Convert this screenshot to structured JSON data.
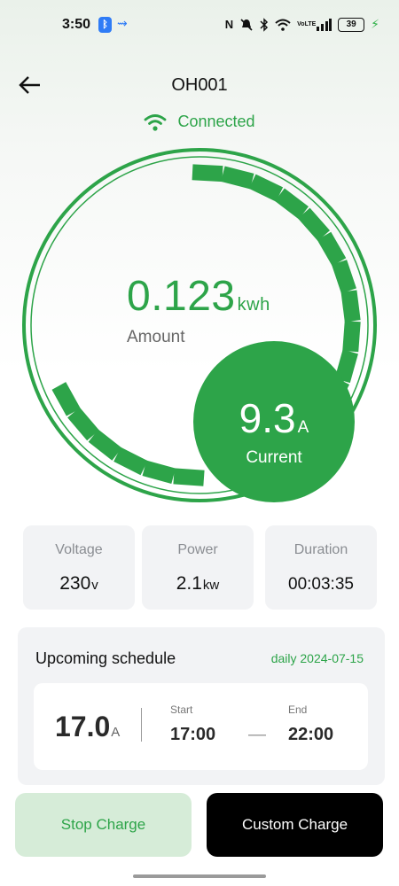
{
  "status_bar": {
    "time": "3:50",
    "bluetooth_badge": "ᛒ",
    "share": "⇝",
    "nfc": "N",
    "volte": "VoLTE",
    "battery": "39",
    "icons": [
      "bluetooth-icon",
      "share-icon",
      "nfc-icon",
      "mute-icon",
      "wifi-icon",
      "volte-icon",
      "signal-icon",
      "battery-icon",
      "charging-bolt-icon"
    ]
  },
  "header": {
    "title": "OH001",
    "back_icon": "arrow-left-icon"
  },
  "connection": {
    "status": "Connected",
    "icon": "wifi-icon"
  },
  "gauge": {
    "amount_value": "0.123",
    "amount_unit": "kwh",
    "amount_label": "Amount",
    "current_value": "9.3",
    "current_unit": "A",
    "current_label": "Current"
  },
  "stats": {
    "voltage": {
      "label": "Voltage",
      "value": "230",
      "unit": "v"
    },
    "power": {
      "label": "Power",
      "value": "2.1",
      "unit": "kw"
    },
    "duration": {
      "label": "Duration",
      "value": "00:03:35"
    }
  },
  "schedule": {
    "title": "Upcoming schedule",
    "date": "daily 2024-07-15",
    "amp_value": "17.0",
    "amp_unit": "A",
    "start_label": "Start",
    "start_time": "17:00",
    "separator": "—",
    "end_label": "End",
    "end_time": "22:00"
  },
  "actions": {
    "stop_label": "Stop Charge",
    "custom_label": "Custom Charge"
  },
  "colors": {
    "accent": "#2da449",
    "accent_light": "#d6ecd8",
    "card_bg": "#f2f3f5"
  }
}
